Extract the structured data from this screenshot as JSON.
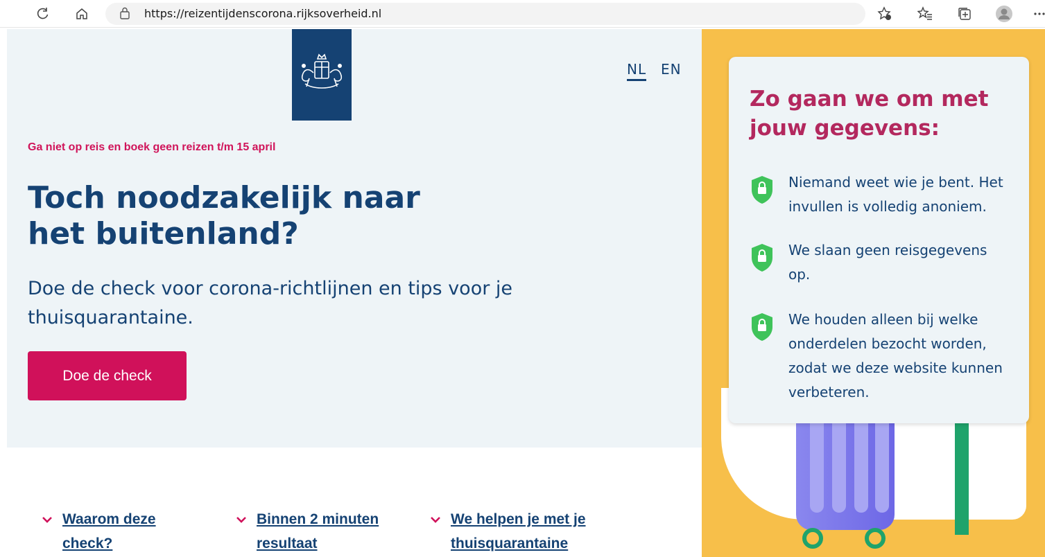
{
  "browser": {
    "url": "https://reizentijdenscorona.rijksoverheid.nl",
    "icons": [
      "refresh-icon",
      "home-icon",
      "lock-icon",
      "favorites-add-icon",
      "favorites-icon",
      "collections-icon",
      "profile-icon",
      "more-icon"
    ]
  },
  "header": {
    "lang_nl": "NL",
    "lang_en": "EN"
  },
  "hero": {
    "alert": "Ga niet op reis en boek geen reizen t/m 15 april",
    "title_line1": "Toch noodzakelijk naar",
    "title_line2": "het buitenland?",
    "lead_line1": "Doe de check voor corona-richtlijnen en tips voor je",
    "lead_line2": "thuisquarantaine.",
    "cta": "Doe de check"
  },
  "links": [
    {
      "line1": "Waarom deze",
      "line2": "check?"
    },
    {
      "line1": "Binnen 2 minuten",
      "line2": "resultaat"
    },
    {
      "line1": "We helpen je met je",
      "line2": "thuisquarantaine"
    }
  ],
  "privacy": {
    "title_line1": "Zo gaan we om met",
    "title_line2": "jouw gegevens:",
    "items": [
      {
        "lines": [
          "Niemand weet wie je bent. Het",
          "invullen is volledig anoniem."
        ]
      },
      {
        "lines": [
          "We slaan geen reisgegevens",
          "op."
        ]
      },
      {
        "lines": [
          "We houden alleen bij welke",
          "onderdelen bezocht worden,",
          "zodat we deze website kunnen",
          "verbeteren."
        ]
      }
    ]
  },
  "colors": {
    "brand_blue": "#154273",
    "accent_red": "#d0115a",
    "title_red": "#b3285e",
    "hero_bg": "#eef4f7",
    "panel_yellow": "#f7bf4a",
    "shield_green": "#3fc35a"
  }
}
